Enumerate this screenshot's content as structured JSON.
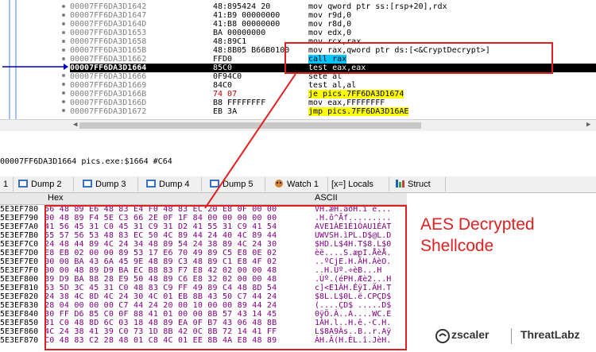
{
  "disasm": {
    "rows": [
      {
        "addr": "00007FF6DA3D1642",
        "bytes": "48:895424 20",
        "instr": "mov qword ptr ss:[rsp+20],rdx"
      },
      {
        "addr": "00007FF6DA3D1647",
        "bytes": "41:B9 00000000",
        "instr": "mov r9d,0"
      },
      {
        "addr": "00007FF6DA3D164D",
        "bytes": "41:B8 00000000",
        "instr": "mov r8d,0"
      },
      {
        "addr": "00007FF6DA3D1653",
        "bytes": "BA 00000000",
        "instr": "mov edx,0"
      },
      {
        "addr": "00007FF6DA3D1658",
        "bytes": "48:89C1",
        "instr": "mov rcx,rax"
      },
      {
        "addr": "00007FF6DA3D165B",
        "bytes": "48:8B05 B66B0100",
        "instr": "mov rax,qword ptr ds:[<&CryptDecrypt>]"
      },
      {
        "addr": "00007FF6DA3D1662",
        "bytes": "FFD0",
        "instr": "call rax"
      },
      {
        "addr": "00007FF6DA3D1664",
        "bytes": "85C0",
        "instr": "test eax,eax"
      },
      {
        "addr": "00007FF6DA3D1666",
        "bytes": "0F94C0",
        "instr": "sete al"
      },
      {
        "addr": "00007FF6DA3D1669",
        "bytes": "84C0",
        "instr": "test al,al"
      },
      {
        "addr": "00007FF6DA3D166B",
        "bytes": "74 07",
        "instr": "je pics.7FF6DA3D1674"
      },
      {
        "addr": "00007FF6DA3D166D",
        "bytes": "B8 FFFFFFFF",
        "instr": "mov eax,FFFFFFFF"
      },
      {
        "addr": "00007FF6DA3D1672",
        "bytes": "EB 3A",
        "instr": "jmp pics.7FF6DA3D16AE"
      }
    ]
  },
  "status_line": "00007FF6DA3D1664 pics.exe:$1664 #C64",
  "tabs": [
    {
      "label": "1"
    },
    {
      "label": "Dump 2"
    },
    {
      "label": "Dump 3"
    },
    {
      "label": "Dump 4"
    },
    {
      "label": "Dump 5"
    },
    {
      "label": "Watch 1"
    },
    {
      "label": "[x=] Locals"
    },
    {
      "label": "Struct"
    }
  ],
  "dump": {
    "col_hex": "Hex",
    "col_ascii": "ASCII",
    "rows": [
      {
        "addr": "5E3EF780",
        "hex": "56 48 89 E6 48 83 E4 F0 48 83 EC 20 E8 0F 00 00",
        "ascii": "VH.æH.äðH.ì è..."
      },
      {
        "addr": "5E3EF790",
        "hex": "00 48 89 F4 5E C3 66 2E 0F 1F 84 00 00 00 00 00",
        "ascii": ".H.ô^Ãf........."
      },
      {
        "addr": "5E3EF7A0",
        "hex": "41 56 45 31 C0 45 31 C9 31 D2 41 55 31 C9 41 54",
        "ascii": "AVE1ÀE1É1ÒAU1ÉAT"
      },
      {
        "addr": "5E3EF7B0",
        "hex": "55 57 56 53 48 83 EC 50 4C 89 44 24 40 4C 89 44",
        "ascii": "UWVSH.ìPL.D$@L.D"
      },
      {
        "addr": "5E3EF7C0",
        "hex": "24 48 44 89 4C 24 34 48 89 54 24 38 89 4C 24 30",
        "ascii": "$HD.L$4H.T$8.L$0"
      },
      {
        "addr": "5E3EF7D0",
        "hex": "E8 EB 02 00 00 89 53 17 E6 70 49 89 C5 E8 0E 02",
        "ascii": "èë....S.æpI.ÅèÅ."
      },
      {
        "addr": "5E3EF7E0",
        "hex": "00 00 BA 43 6A 45 9E 48 89 C3 48 89 C1 E8 4F 02",
        "ascii": "..ºCjE.H.ÃH.ÁèO."
      },
      {
        "addr": "5E3EF7F0",
        "hex": "00 00 48 89 D9 BA EC B8 83 F7 E8 42 02 00 00 48",
        "ascii": "..H.Ùº.÷èB...H"
      },
      {
        "addr": "5E3EF800",
        "hex": "89 D9 BA 88 28 E9 50 48 89 C6 E8 32 02 00 00 48",
        "ascii": ".Ùº.(éPH.Æè2...H"
      },
      {
        "addr": "5E3EF810",
        "hex": "63 5D 3C 45 31 C0 48 83 C9 FF 49 89 C4 48 8D 54",
        "ascii": "c]<E1ÀH.ÉÿI.ÄH.T"
      },
      {
        "addr": "5E3EF820",
        "hex": "24 38 4C 8D 4C 24 30 4C 01 EB 8B 43 50 C7 44 24",
        "ascii": "$8L.L$0L.ë.CPÇD$"
      },
      {
        "addr": "5E3EF830",
        "hex": "28 04 00 00 00 C7 44 24 20 00 10 00 00 89 44 24",
        "ascii": "(....ÇD$ .....D$"
      },
      {
        "addr": "5E3EF840",
        "hex": "30 FF D6 85 C0 0F 88 41 01 00 00 8B 57 43 14 45",
        "ascii": "0ÿÖ.À..A....WC.E"
      },
      {
        "addr": "5E3EF850",
        "hex": "31 C0 48 8D 6C 03 18 48 89 EA 0F B7 43 06 48 8B",
        "ascii": "1ÀH.l..H.ê.·C.H."
      },
      {
        "addr": "5E3EF860",
        "hex": "4C 24 38 41 39 C0 73 1D 8B 42 0C 8B 72 14 41 FF",
        "ascii": "L$8A9Às..B..r.Aÿ"
      },
      {
        "addr": "5E3EF870",
        "hex": "C0 48 83 C2 28 48 01 C8 4C 01 EE 8B 4A E8 48 89",
        "ascii": "ÀH.Â(H.ÈL.î.JèH."
      }
    ]
  },
  "annotation": {
    "line1": "AES Decrypted",
    "line2": "Shellcode"
  },
  "branding": {
    "zscaler": "zscaler",
    "threatlabz": "ThreatLabz"
  },
  "colors": {
    "accent_red": "#e02020",
    "call_highlight": "#00c8ff",
    "jump_highlight": "#ffff00",
    "dump_text": "#800080"
  }
}
